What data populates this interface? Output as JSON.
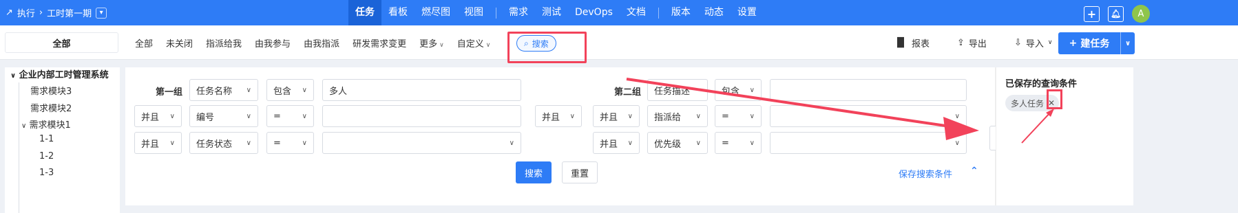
{
  "breadcrumb": {
    "root": "执行",
    "project": "工时第一期"
  },
  "topnav": [
    "任务",
    "看板",
    "燃尽图",
    "视图",
    "需求",
    "测试",
    "DevOps",
    "文档",
    "版本",
    "动态",
    "设置"
  ],
  "avatar": "A",
  "filter": {
    "all_label": "全部",
    "views": [
      "全部",
      "未关闭",
      "指派给我",
      "由我参与",
      "由我指派",
      "研发需求变更",
      "更多",
      "自定义"
    ],
    "search_label": "搜索",
    "report_label": "报表",
    "export_label": "导出",
    "import_label": "导入",
    "new_task_label": "建任务"
  },
  "tree": {
    "root": "企业内部工时管理系统",
    "items": [
      "需求模块3",
      "需求模块2",
      "需求模块1",
      "1-1",
      "1-2",
      "1-3"
    ]
  },
  "search": {
    "group1_label": "第一组",
    "group2_label": "第二组",
    "g1": [
      {
        "join": "",
        "field": "任务名称",
        "op": "包含",
        "value": "多人"
      },
      {
        "join": "并且",
        "field": "编号",
        "op": "=",
        "value": ""
      },
      {
        "join": "并且",
        "field": "任务状态",
        "op": "=",
        "value": ""
      }
    ],
    "middle_join": "并且",
    "g2": [
      {
        "join": "",
        "field": "任务描述",
        "op": "包含",
        "value": ""
      },
      {
        "join": "并且",
        "field": "指派给",
        "op": "=",
        "value": ""
      },
      {
        "join": "并且",
        "field": "优先级",
        "op": "=",
        "value": ""
      }
    ],
    "search_button": "搜索",
    "reset_button": "重置",
    "save_link": "保存搜索条件"
  },
  "saved": {
    "title": "已保存的查询条件",
    "tags": [
      "多人任务"
    ]
  },
  "colors": {
    "primary": "#2e7cf6",
    "annotation": "#f2425a"
  }
}
